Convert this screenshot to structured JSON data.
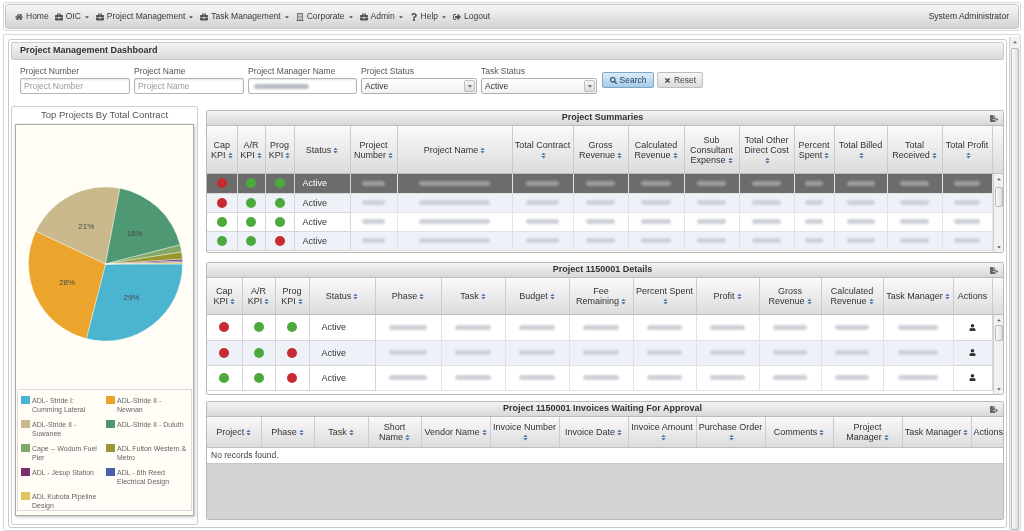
{
  "nav": {
    "items": [
      {
        "kind": "home",
        "label": "Home",
        "dropdown": false
      },
      {
        "kind": "module",
        "label": "OIC",
        "dropdown": true
      },
      {
        "kind": "module",
        "label": "Project Management",
        "dropdown": true
      },
      {
        "kind": "module",
        "label": "Task Management",
        "dropdown": true
      },
      {
        "kind": "building",
        "label": "Corporate",
        "dropdown": true
      },
      {
        "kind": "module",
        "label": "Admin",
        "dropdown": true
      },
      {
        "kind": "help",
        "label": "Help",
        "dropdown": true
      },
      {
        "kind": "logout",
        "label": "Logout",
        "dropdown": false
      }
    ],
    "user": "System Administrator"
  },
  "dashboard": {
    "title": "Project Management Dashboard",
    "filters": [
      {
        "kind": "text",
        "label": "Project Number",
        "placeholder": "Project Number"
      },
      {
        "kind": "text",
        "label": "Project Name",
        "placeholder": "Project Name"
      },
      {
        "kind": "redacted",
        "label": "Project Manager Name"
      },
      {
        "kind": "select",
        "label": "Project Status",
        "value": "Active"
      },
      {
        "kind": "select",
        "label": "Task Status",
        "value": "Active"
      }
    ],
    "buttons": [
      {
        "kind": "search",
        "label": "Search"
      },
      {
        "kind": "reset",
        "label": "Reset"
      }
    ]
  },
  "chart_panel": {
    "chart_data": {
      "type": "pie",
      "title": "Top Projects By Total Contract",
      "categories": [
        "ADL- Stride I: Cumming Lateral",
        "ADL-Stride II - Newnan",
        "ADL-Stride II - Suwanee",
        "ADL-Stride II - Duluth",
        "Cape -- Wodum Fuel Pier",
        "ADL Fulton Western & Metro",
        "ADL - Jesup Station",
        "ADL - 6th Reed Electrical Design",
        "ADL Kubota Pipeline Design"
      ],
      "values": [
        29,
        28,
        21,
        18,
        1.5,
        1.5,
        0.4,
        0.3,
        0.3
      ],
      "colors": [
        "#4bb4cf",
        "#eba52d",
        "#c9b98c",
        "#4f9874",
        "#82a96a",
        "#9a9630",
        "#7b2d6c",
        "#4a5cb4",
        "#e3c45c"
      ],
      "value_labels": [
        "29%",
        "28%",
        "21%",
        "18%",
        null,
        null,
        null,
        null,
        null
      ]
    }
  },
  "project_summaries": {
    "title": "Project Summaries",
    "columns": [
      {
        "kind": "kpi",
        "label": "Cap KPI",
        "sortable": true
      },
      {
        "kind": "kpi",
        "label": "A/R KPI",
        "sortable": true
      },
      {
        "kind": "kpi",
        "label": "Prog KPI",
        "sortable": true
      },
      {
        "kind": "status",
        "label": "Status",
        "sortable": true
      },
      {
        "kind": "redacted",
        "label": "Project Number",
        "sortable": true
      },
      {
        "kind": "redacted",
        "label": "Project Name",
        "sortable": true
      },
      {
        "kind": "redacted",
        "label": "Total Contract",
        "sortable": true
      },
      {
        "kind": "redacted",
        "label": "Gross Revenue",
        "sortable": true
      },
      {
        "kind": "redacted",
        "label": "Calculated Revenue",
        "sortable": true
      },
      {
        "kind": "redacted",
        "label": "Sub Consultant Expense",
        "sortable": true
      },
      {
        "kind": "redacted",
        "label": "Total Other Direct Cost",
        "sortable": true
      },
      {
        "kind": "redacted",
        "label": "Percent Spent",
        "sortable": true
      },
      {
        "kind": "redacted",
        "label": "Total Billed",
        "sortable": true
      },
      {
        "kind": "redacted",
        "label": "Total Received",
        "sortable": true
      },
      {
        "kind": "redacted",
        "label": "Total Profit",
        "sortable": true
      }
    ],
    "rows": [
      {
        "selected": true,
        "kpis": [
          {
            "color": "#c62b32"
          },
          {
            "color": "#4caa3c"
          },
          {
            "color": "#4caa3c"
          }
        ],
        "status": "Active"
      },
      {
        "selected": false,
        "kpis": [
          {
            "color": "#c62b32"
          },
          {
            "color": "#4caa3c"
          },
          {
            "color": "#4caa3c"
          }
        ],
        "status": "Active"
      },
      {
        "selected": false,
        "kpis": [
          {
            "color": "#4caa3c"
          },
          {
            "color": "#4caa3c"
          },
          {
            "color": "#4caa3c"
          }
        ],
        "status": "Active"
      },
      {
        "selected": false,
        "kpis": [
          {
            "color": "#4caa3c"
          },
          {
            "color": "#4caa3c"
          },
          {
            "color": "#c62b32"
          }
        ],
        "status": "Active"
      }
    ]
  },
  "project_details": {
    "title": "Project 1150001 Details",
    "columns": [
      {
        "kind": "kpi",
        "label": "Cap KPI",
        "sortable": true
      },
      {
        "kind": "kpi",
        "label": "A/R KPI",
        "sortable": true
      },
      {
        "kind": "kpi",
        "label": "Prog KPI",
        "sortable": true
      },
      {
        "kind": "status",
        "label": "Status",
        "sortable": true
      },
      {
        "kind": "redacted",
        "label": "Phase",
        "sortable": true
      },
      {
        "kind": "redacted",
        "label": "Task",
        "sortable": true
      },
      {
        "kind": "redacted",
        "label": "Budget",
        "sortable": true
      },
      {
        "kind": "redacted",
        "label": "Fee Remaining",
        "sortable": true
      },
      {
        "kind": "redacted",
        "label": "Percent Spent",
        "sortable": true
      },
      {
        "kind": "redacted",
        "label": "Profit",
        "sortable": true
      },
      {
        "kind": "redacted",
        "label": "Gross Revenue",
        "sortable": true
      },
      {
        "kind": "redacted",
        "label": "Calculated Revenue",
        "sortable": true
      },
      {
        "kind": "redacted",
        "label": "Task Manager",
        "sortable": true
      },
      {
        "kind": "actions",
        "label": "Actions",
        "sortable": false
      }
    ],
    "rows": [
      {
        "selected": false,
        "kpis": [
          {
            "color": "#c62b32"
          },
          {
            "color": "#4caa3c"
          },
          {
            "color": "#4caa3c"
          }
        ],
        "status": "Active"
      },
      {
        "selected": false,
        "kpis": [
          {
            "color": "#c62b32"
          },
          {
            "color": "#4caa3c"
          },
          {
            "color": "#c62b32"
          }
        ],
        "status": "Active"
      },
      {
        "selected": false,
        "kpis": [
          {
            "color": "#4caa3c"
          },
          {
            "color": "#4caa3c"
          },
          {
            "color": "#c62b32"
          }
        ],
        "status": "Active"
      }
    ]
  },
  "invoices": {
    "title": "Project 1150001 Invoices Waiting For Approval",
    "columns": [
      {
        "label": "Project",
        "sortable": true
      },
      {
        "label": "Phase",
        "sortable": true
      },
      {
        "label": "Task",
        "sortable": true
      },
      {
        "label": "Short Name",
        "sortable": true
      },
      {
        "label": "Vendor Name",
        "sortable": true
      },
      {
        "label": "Invoice Number",
        "sortable": true
      },
      {
        "label": "Invoice Date",
        "sortable": true
      },
      {
        "label": "Invoice Amount",
        "sortable": true
      },
      {
        "label": "Purchase Order",
        "sortable": true
      },
      {
        "label": "Comments",
        "sortable": true
      },
      {
        "label": "Project Manager",
        "sortable": true
      },
      {
        "label": "Task Manager",
        "sortable": true
      },
      {
        "label": "Actions",
        "sortable": false
      }
    ],
    "empty_message": "No records found."
  }
}
